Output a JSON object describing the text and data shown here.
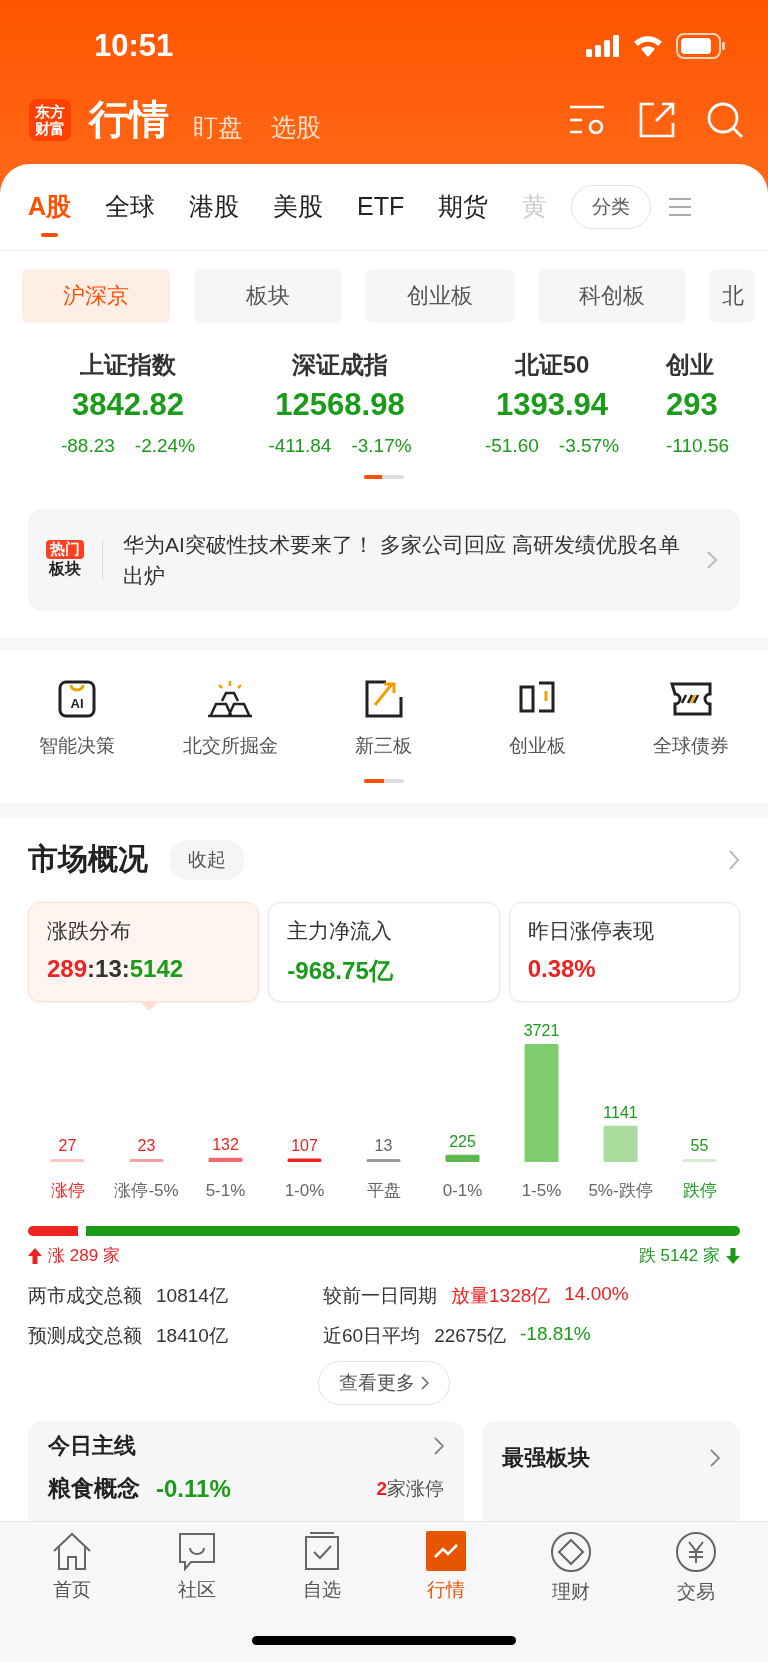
{
  "status_bar": {
    "time": "10:51"
  },
  "header": {
    "logo": "东方财富",
    "title": "行情",
    "links": [
      "盯盘",
      "选股"
    ]
  },
  "tabs": [
    {
      "label": "A股",
      "selected": true,
      "faded": false
    },
    {
      "label": "全球",
      "selected": false,
      "faded": false
    },
    {
      "label": "港股",
      "selected": false,
      "faded": false
    },
    {
      "label": "美股",
      "selected": false,
      "faded": false
    },
    {
      "label": "ETF",
      "selected": false,
      "faded": false
    },
    {
      "label": "期货",
      "selected": false,
      "faded": false
    },
    {
      "label": "黄",
      "selected": false,
      "faded": true
    }
  ],
  "tabs_more": {
    "label": "分类"
  },
  "sub_tabs": [
    {
      "label": "沪深京",
      "selected": true
    },
    {
      "label": "板块",
      "selected": false
    },
    {
      "label": "创业板",
      "selected": false
    },
    {
      "label": "科创板",
      "selected": false
    },
    {
      "label": "北",
      "selected": false
    }
  ],
  "indices": [
    {
      "name": "上证指数",
      "value": "3842.82",
      "change": "-88.23",
      "percent": "-2.24%",
      "color": "#1a9c1a"
    },
    {
      "name": "深证成指",
      "value": "12568.98",
      "change": "-411.84",
      "percent": "-3.17%",
      "color": "#1a9c1a"
    },
    {
      "name": "北证50",
      "value": "1393.94",
      "change": "-51.60",
      "percent": "-3.57%",
      "color": "#1a9c1a"
    },
    {
      "name": "创业",
      "value": "293",
      "change": "-110.56",
      "color": "#1a9c1a"
    }
  ],
  "indices_pager": {
    "level": 0.45
  },
  "hot_banner": {
    "badge_top": "热门",
    "badge_bottom": "板块",
    "text": "华为AI突破性技术要来了！ 多家公司回应 高研发绩优股名单出炉"
  },
  "shortcuts": [
    {
      "label": "智能决策",
      "kind": "ai",
      "icon_text": "AI"
    },
    {
      "label": "北交所掘金",
      "kind": "ingots"
    },
    {
      "label": "新三板",
      "kind": "board"
    },
    {
      "label": "创业板",
      "kind": "growth"
    },
    {
      "label": "全球债券",
      "kind": "bond"
    }
  ],
  "shortcuts_pager": {
    "level": 0.5
  },
  "market": {
    "title": "市场概况",
    "collapse": "收起",
    "cards": [
      {
        "title": "涨跌分布",
        "selected": true,
        "parts": [
          {
            "text": "289",
            "color": "#ee2222"
          },
          {
            "text": ":",
            "color": "#333333"
          },
          {
            "text": "13",
            "color": "#333333"
          },
          {
            "text": ":",
            "color": "#333333"
          },
          {
            "text": "5142",
            "color": "#1a9c1a"
          }
        ]
      },
      {
        "title": "主力净流入",
        "selected": false,
        "parts": [
          {
            "text": "-968.75亿",
            "color": "#1a9c1a"
          }
        ]
      },
      {
        "title": "昨日涨停表现",
        "selected": false,
        "parts": [
          {
            "text": "0.38%",
            "color": "#ee2222"
          }
        ]
      }
    ],
    "chart_data": {
      "type": "bar",
      "categories": [
        "涨停",
        "涨停-5%",
        "5-1%",
        "1-0%",
        "平盘",
        "0-1%",
        "1-5%",
        "5%-跌停",
        "跌停"
      ],
      "series": [
        {
          "values": [
            27,
            23,
            132,
            107,
            13,
            225,
            3721,
            1141,
            55
          ]
        }
      ],
      "data_labels": true
    },
    "bar_styles": [
      {
        "bar": {
          "color": "#fbc6c6"
        },
        "value": {
          "color": "#ee2222"
        },
        "label": {
          "color": "#ee2222"
        }
      },
      {
        "bar": {
          "color": "#f7a0a0"
        },
        "value": {
          "color": "#ee2222"
        },
        "label": {
          "color": "#666666"
        }
      },
      {
        "bar": {
          "color": "#f26a6a"
        },
        "value": {
          "color": "#ee2222"
        },
        "label": {
          "color": "#666666"
        }
      },
      {
        "bar": {
          "color": "#ee2222"
        },
        "value": {
          "color": "#ee2222"
        },
        "label": {
          "color": "#666666"
        }
      },
      {
        "bar": {
          "color": "#999999"
        },
        "value": {
          "color": "#666666"
        },
        "label": {
          "color": "#666666"
        }
      },
      {
        "bar": {
          "color": "#5cb84a"
        },
        "value": {
          "color": "#1a9c1a"
        },
        "label": {
          "color": "#666666"
        }
      },
      {
        "bar": {
          "color": "#7fcc6e"
        },
        "value": {
          "color": "#1a9c1a"
        },
        "label": {
          "color": "#666666"
        }
      },
      {
        "bar": {
          "color": "#a9dc9d"
        },
        "value": {
          "color": "#1a9c1a"
        },
        "label": {
          "color": "#666666"
        }
      },
      {
        "bar": {
          "color": "#d4ecd0"
        },
        "value": {
          "color": "#1a9c1a"
        },
        "label": {
          "color": "#1a9c1a"
        }
      }
    ],
    "ratio": {
      "level": 0.07,
      "up_label": "涨 289 家",
      "down_label": "跌 5142 家"
    },
    "stats": [
      {
        "label": "两市成交总额",
        "values": [
          {
            "text": "10814亿",
            "color": "#333333"
          }
        ]
      },
      {
        "label": "较前一日同期",
        "values": [
          {
            "text": "放量1328亿",
            "color": "#ee2222"
          },
          {
            "text": "14.00%",
            "color": "#ee2222"
          }
        ]
      },
      {
        "label": "预测成交总额",
        "values": [
          {
            "text": "18410亿",
            "color": "#333333"
          }
        ]
      },
      {
        "label": "近60日平均",
        "values": [
          {
            "text": "22675亿",
            "color": "#333333"
          },
          {
            "text": "-18.81%",
            "color": "#1a9c1a"
          }
        ]
      }
    ],
    "more": "查看更多"
  },
  "mainline": {
    "title": "今日主线",
    "name": "粮食概念",
    "percent": "-0.11%",
    "color": "#1a9c1a",
    "count": "2",
    "count_label": "家涨停"
  },
  "strongest": {
    "title": "最强板块"
  },
  "bottom_nav": [
    {
      "label": "首页",
      "kind": "home",
      "selected": false
    },
    {
      "label": "社区",
      "kind": "chat",
      "selected": false
    },
    {
      "label": "自选",
      "kind": "check",
      "selected": false
    },
    {
      "label": "行情",
      "kind": "chart",
      "selected": true
    },
    {
      "label": "理财",
      "kind": "diamond",
      "selected": false
    },
    {
      "label": "交易",
      "kind": "yen",
      "selected": false
    }
  ]
}
